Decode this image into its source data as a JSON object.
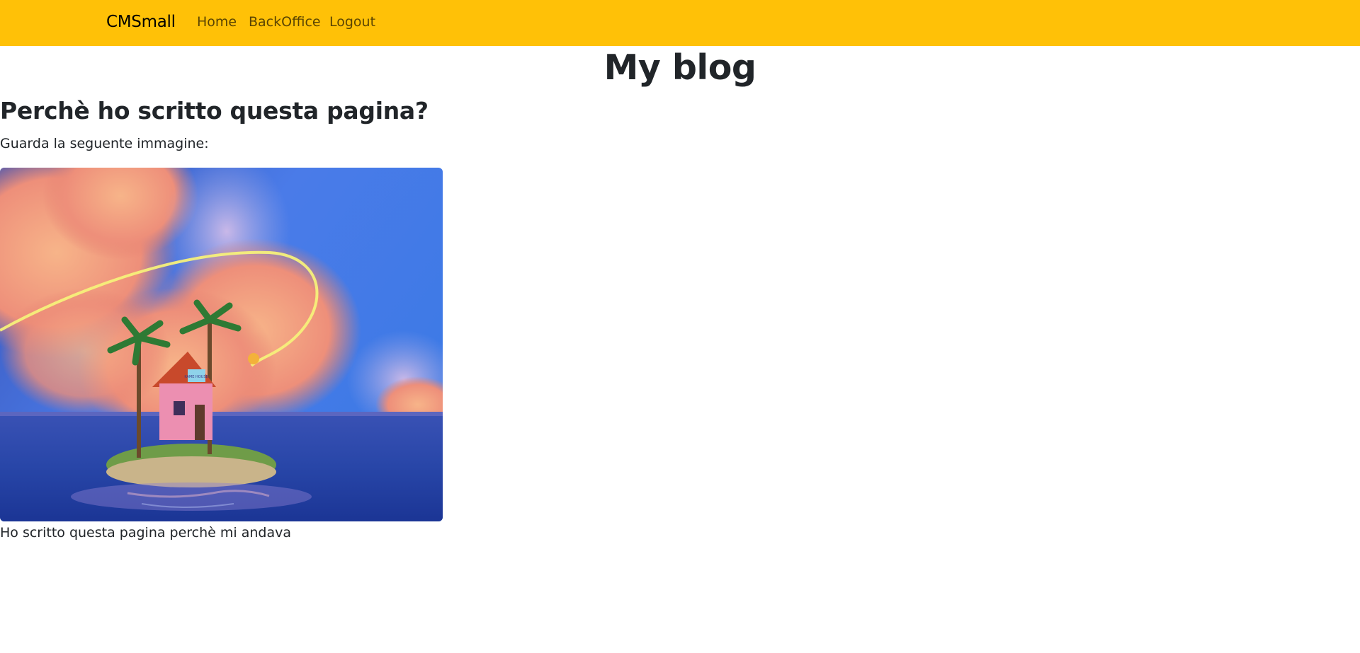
{
  "navbar": {
    "brand": "CMSmall",
    "links": [
      {
        "label": "Home"
      },
      {
        "label": "BackOffice"
      },
      {
        "label": "Logout"
      }
    ],
    "background": "#ffc107"
  },
  "page": {
    "title": "My blog"
  },
  "article": {
    "heading": "Perchè ho scritto questa pagina?",
    "paragraph_1": "Guarda la seguente immagine:",
    "image_icon": "island-house-illustration",
    "image_sign": "KAME HOUSE",
    "paragraph_2": "Ho scritto questa pagina perchè mi andava"
  }
}
